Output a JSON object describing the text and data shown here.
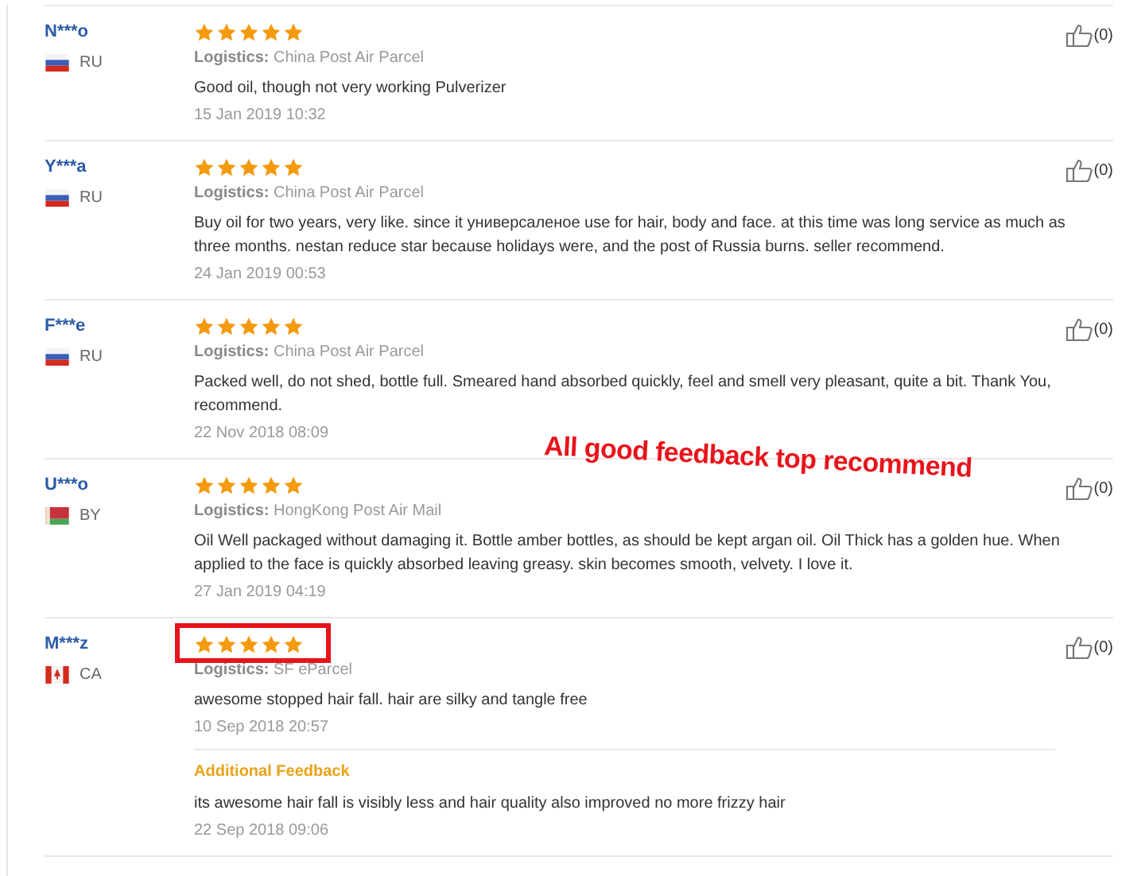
{
  "reviews": [
    {
      "user": "N***o",
      "flag": {
        "kind": "ru"
      },
      "country": "RU",
      "stars": 5,
      "highlighted": false,
      "logistics_label": "Logistics:",
      "logistics": "China Post Air Parcel",
      "text": "Good oil, though not very working Pulverizer",
      "date": "15 Jan 2019 10:32",
      "likes": "(0)"
    },
    {
      "user": "Y***a",
      "flag": {
        "kind": "ru"
      },
      "country": "RU",
      "stars": 5,
      "highlighted": false,
      "logistics_label": "Logistics:",
      "logistics": "China Post Air Parcel",
      "text": "Buy oil for two years, very like. since it универсаленое use for hair, body and face. at this time was long service as much as three months. nestan reduce star because holidays were, and the post of Russia burns. seller recommend.",
      "date": "24 Jan 2019 00:53",
      "likes": "(0)"
    },
    {
      "user": "F***e",
      "flag": {
        "kind": "ru"
      },
      "country": "RU",
      "stars": 5,
      "highlighted": false,
      "logistics_label": "Logistics:",
      "logistics": "China Post Air Parcel",
      "text": "Packed well, do not shed, bottle full. Smeared hand absorbed quickly, feel and smell very pleasant, quite a bit. Thank You, recommend.",
      "date": "22 Nov 2018 08:09",
      "likes": "(0)"
    },
    {
      "user": "U***o",
      "flag": {
        "kind": "by"
      },
      "country": "BY",
      "stars": 5,
      "highlighted": false,
      "logistics_label": "Logistics:",
      "logistics": "HongKong Post Air Mail",
      "text": "Oil Well packaged without damaging it. Bottle amber bottles, as should be kept argan oil. Oil Thick has a golden hue. When applied to the face is quickly absorbed leaving greasy. skin becomes smooth, velvety. I love it.",
      "date": "27 Jan 2019 04:19",
      "likes": "(0)"
    },
    {
      "user": "M***z",
      "flag": {
        "kind": "ca"
      },
      "country": "CA",
      "stars": 5,
      "highlighted": true,
      "logistics_label": "Logistics:",
      "logistics": "SF eParcel",
      "text": "awesome stopped hair fall. hair are silky and tangle free",
      "date": "10 Sep 2018 20:57",
      "likes": "(0)",
      "additional": {
        "title": "Additional Feedback",
        "text": "its awesome hair fall is visibly less and hair quality also improved no more frizzy hair",
        "date": "22 Sep 2018 09:06"
      }
    }
  ],
  "annotation": "All good feedback top recommend"
}
